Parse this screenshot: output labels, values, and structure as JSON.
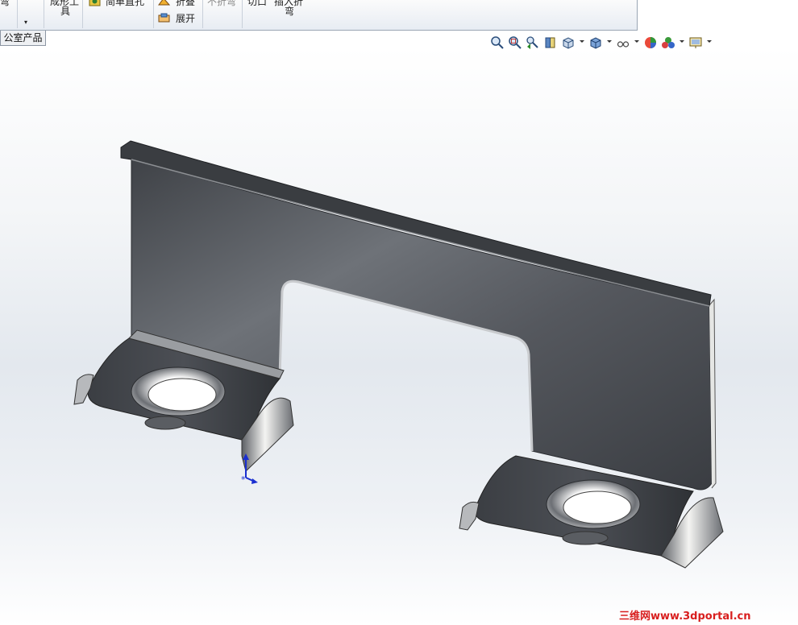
{
  "ribbon": {
    "items": [
      {
        "label": "弯"
      },
      {
        "label": "成形工"
      },
      {
        "label": "具"
      },
      {
        "label": "简单直孔"
      },
      {
        "label": "折叠"
      },
      {
        "label": "展开"
      },
      {
        "label": "不折弯"
      },
      {
        "label": "切口"
      },
      {
        "label": "插入折"
      },
      {
        "label": "弯"
      }
    ]
  },
  "tab": {
    "label": "公室产品"
  },
  "view_toolbar": {
    "icons": [
      "zoom-to-fit-icon",
      "zoom-to-area-icon",
      "previous-view-icon",
      "section-view-icon",
      "view-orientation-icon",
      "display-style-icon",
      "hide-show-items-icon",
      "edit-appearance-icon",
      "apply-scene-icon",
      "view-settings-icon"
    ]
  },
  "watermark": {
    "text": "三维网www.3dportal.cn"
  },
  "colors": {
    "watermark": "#d81e1e",
    "viewport_gradient": "#e3e8ee"
  }
}
